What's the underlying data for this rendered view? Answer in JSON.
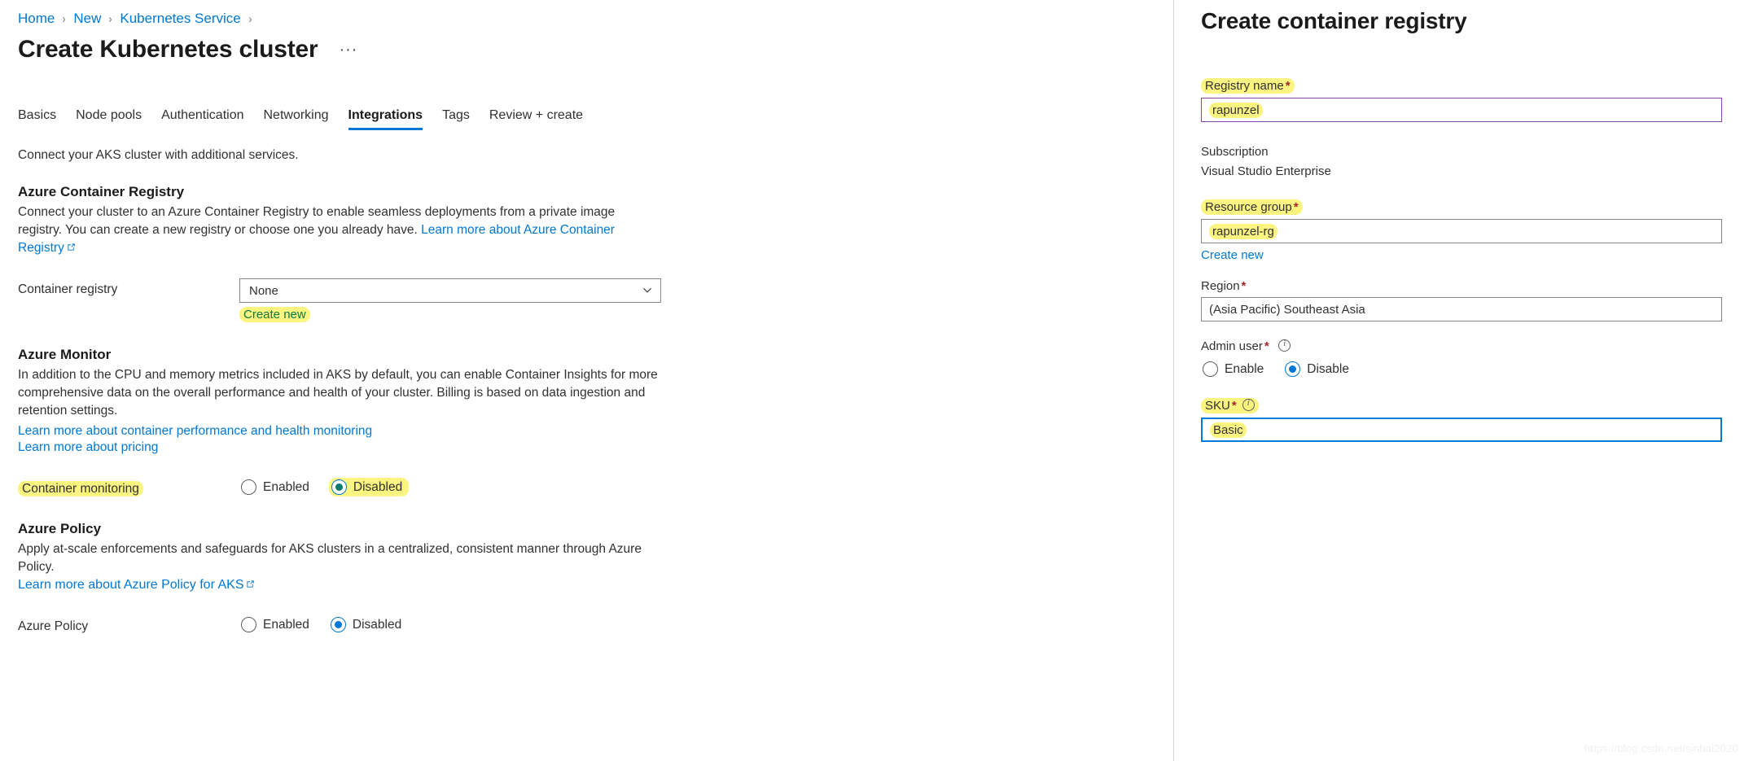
{
  "breadcrumb": {
    "items": [
      {
        "label": "Home"
      },
      {
        "label": "New"
      },
      {
        "label": "Kubernetes Service"
      }
    ],
    "separator": "›"
  },
  "page": {
    "title": "Create Kubernetes cluster",
    "more_actions": "···"
  },
  "tabs": [
    {
      "label": "Basics",
      "active": false
    },
    {
      "label": "Node pools",
      "active": false
    },
    {
      "label": "Authentication",
      "active": false
    },
    {
      "label": "Networking",
      "active": false
    },
    {
      "label": "Integrations",
      "active": true
    },
    {
      "label": "Tags",
      "active": false
    },
    {
      "label": "Review + create",
      "active": false
    }
  ],
  "main": {
    "intro": "Connect your AKS cluster with additional services.",
    "acr": {
      "heading": "Azure Container Registry",
      "description": "Connect your cluster to an Azure Container Registry to enable seamless deployments from a private image registry. You can create a new registry or choose one you already have.",
      "learn_more_link": "Learn more about Azure Container Registry",
      "field_label": "Container registry",
      "selected_value": "None",
      "create_new_label": "Create new"
    },
    "monitor": {
      "heading": "Azure Monitor",
      "description": "In addition to the CPU and memory metrics included in AKS by default, you can enable Container Insights for more comprehensive data on the overall performance and health of your cluster. Billing is based on data ingestion and retention settings.",
      "link_perf": "Learn more about container performance and health monitoring",
      "link_pricing": "Learn more about pricing",
      "field_label": "Container monitoring",
      "options": [
        {
          "label": "Enabled",
          "selected": false
        },
        {
          "label": "Disabled",
          "selected": true
        }
      ]
    },
    "policy": {
      "heading": "Azure Policy",
      "description": "Apply at-scale enforcements and safeguards for AKS clusters in a centralized, consistent manner through Azure Policy.",
      "link": "Learn more about Azure Policy for AKS",
      "field_label": "Azure Policy",
      "options": [
        {
          "label": "Enabled",
          "selected": false
        },
        {
          "label": "Disabled",
          "selected": true
        }
      ]
    }
  },
  "context_pane": {
    "title": "Create container registry",
    "registry_name": {
      "label": "Registry name",
      "required": "*",
      "value": "rapunzel"
    },
    "subscription": {
      "label": "Subscription",
      "value": "Visual Studio Enterprise"
    },
    "resource_group": {
      "label": "Resource group",
      "required": "*",
      "value": "rapunzel-rg",
      "create_new_label": "Create new"
    },
    "region": {
      "label": "Region",
      "required": "*",
      "value": "(Asia Pacific) Southeast Asia"
    },
    "admin_user": {
      "label": "Admin user",
      "required": "*",
      "options": [
        {
          "label": "Enable",
          "selected": false
        },
        {
          "label": "Disable",
          "selected": true
        }
      ]
    },
    "sku": {
      "label": "SKU",
      "required": "*",
      "value": "Basic"
    },
    "watermark": "https://blog.csdn.net/sinbai2020"
  },
  "colors": {
    "accent": "#0078d4",
    "highlight": "#fbf481",
    "required": "#a4262c",
    "focus_border": "#0078d4",
    "validated_border": "#8e44ad",
    "teal_radio": "#0b7a6e"
  }
}
